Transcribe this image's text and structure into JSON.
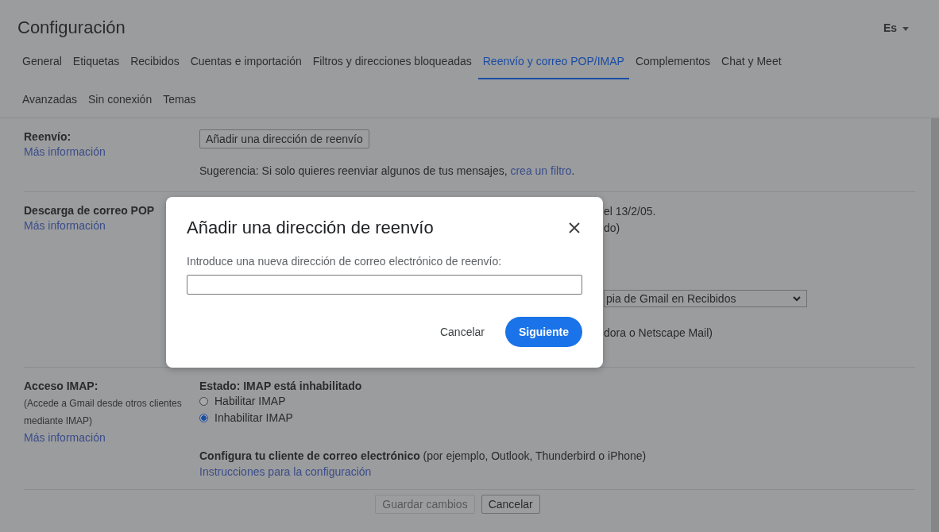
{
  "header": {
    "title": "Configuración",
    "language": "Es"
  },
  "tabs": [
    {
      "label": "General",
      "selected": false
    },
    {
      "label": "Etiquetas",
      "selected": false
    },
    {
      "label": "Recibidos",
      "selected": false
    },
    {
      "label": "Cuentas e importación",
      "selected": false
    },
    {
      "label": "Filtros y direcciones bloqueadas",
      "selected": false
    },
    {
      "label": "Reenvío y correo POP/IMAP",
      "selected": true
    },
    {
      "label": "Complementos",
      "selected": false
    },
    {
      "label": "Chat y Meet",
      "selected": false
    },
    {
      "label": "Avanzadas",
      "selected": false
    },
    {
      "label": "Sin conexión",
      "selected": false
    },
    {
      "label": "Temas",
      "selected": false
    }
  ],
  "forwarding": {
    "label": "Reenvío:",
    "link": "Más información",
    "button": "Añadir una dirección de reenvío",
    "hint": "Sugerencia: Si solo quieres reenviar algunos de tus mensajes,",
    "hint_link": "crea un filtro",
    "hint_end": "."
  },
  "pop": {
    "label": "Descarga de correo POP",
    "link": "Más información",
    "lines": [
      "el 13/2/05.",
      "do)"
    ],
    "select_value": "pia de Gmail en Recibidos",
    "note": "dora o Netscape Mail)"
  },
  "imap": {
    "label": "Acceso IMAP:",
    "description": "(Accede a Gmail desde otros clientes mediante IMAP)",
    "link": "Más información",
    "status": "Estado: IMAP está inhabilitado",
    "options": [
      {
        "label": "Habilitar IMAP",
        "selected": false
      },
      {
        "label": "Inhabilitar IMAP",
        "selected": true
      }
    ],
    "config": "**Configura tu cliente de correo electrónico** (por ejemplo, Outlook, Thunderbird o iPhone)",
    "config_link": "Instrucciones para la configuración"
  },
  "footer_buttons": [
    {
      "label": "Guardar cambios",
      "disabled": true
    },
    {
      "label": "Cancelar",
      "disabled": false
    }
  ],
  "dialog": {
    "title": "Añadir una dirección de reenvío",
    "field_label": "Introduce una nueva dirección de correo electrónico de reenvío:",
    "cancel": "Cancelar",
    "confirm": "Siguiente"
  }
}
